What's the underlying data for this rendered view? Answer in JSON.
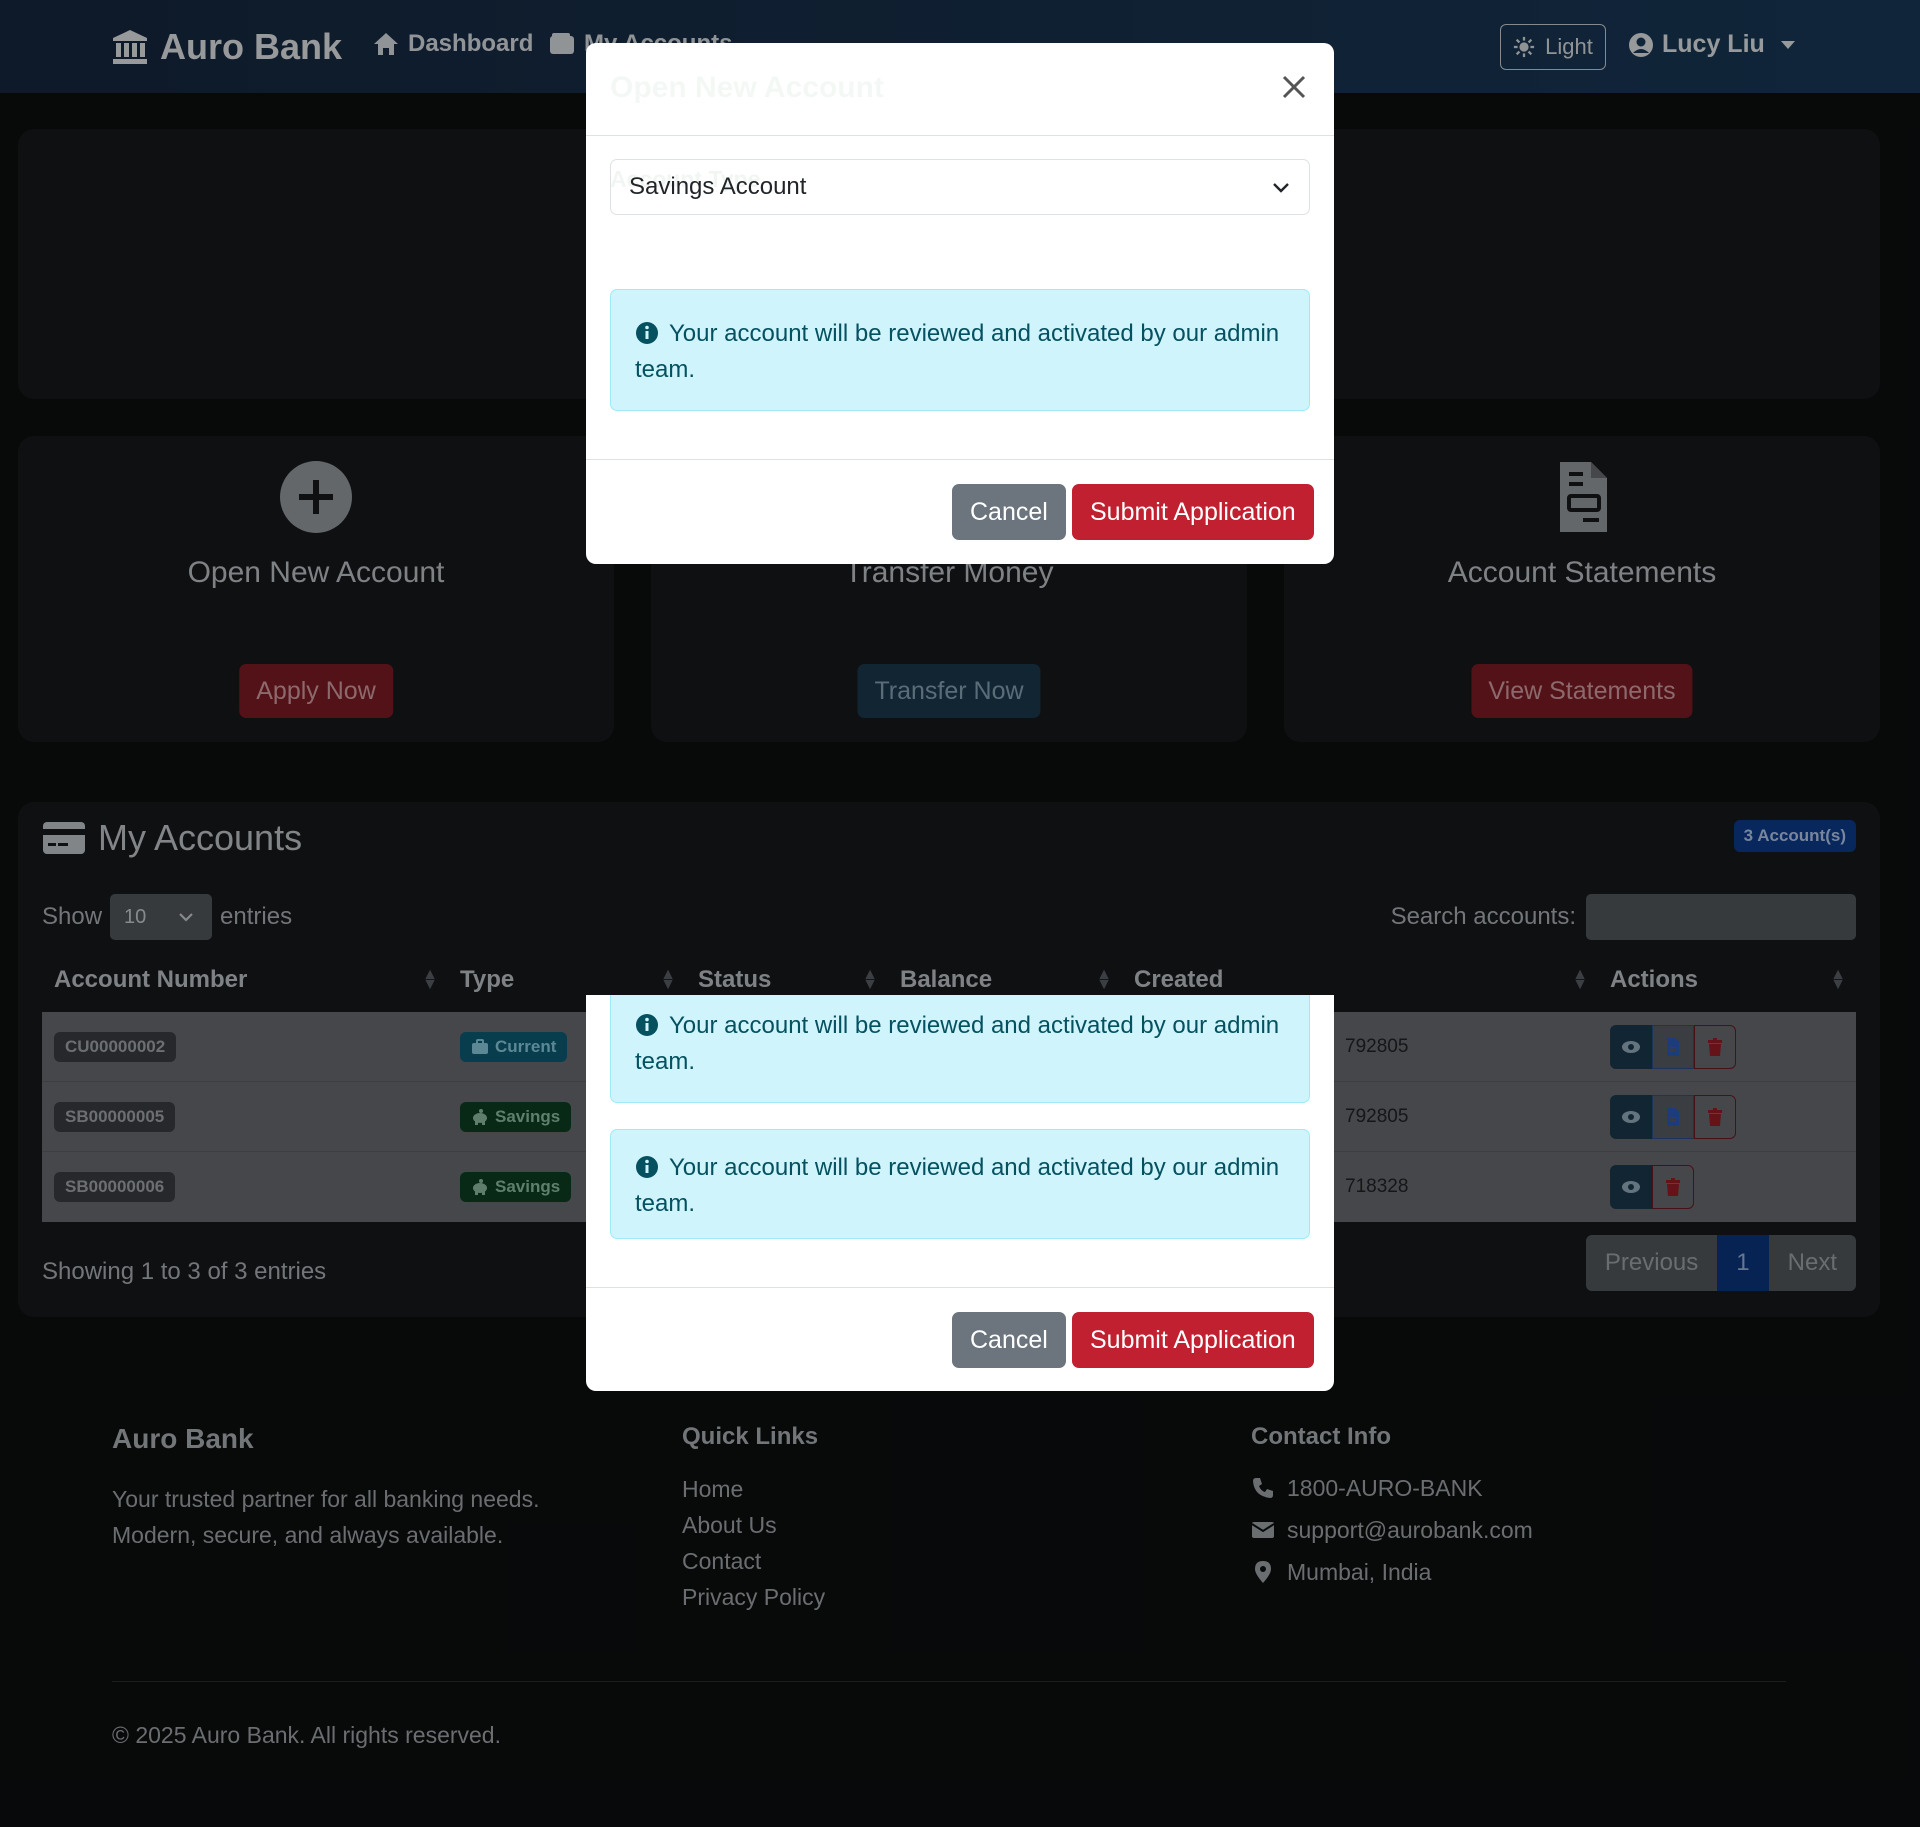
{
  "navbar": {
    "brand": "Auro Bank",
    "links": [
      {
        "label": "Dashboard",
        "icon": "home-icon"
      },
      {
        "label": "My Accounts",
        "icon": "wallet-icon"
      }
    ],
    "theme_toggle": "Light",
    "user_name": "Lucy Liu"
  },
  "quick_actions": [
    {
      "title": "Open New Account",
      "button": "Apply Now",
      "icon": "plus-circle-icon"
    },
    {
      "title": "Transfer Money",
      "button": "Transfer Now",
      "icon": "exchange-icon"
    },
    {
      "title": "Account Statements",
      "button": "View Statements",
      "icon": "file-invoice-icon"
    }
  ],
  "accounts": {
    "title": "My Accounts",
    "badge": "3 Account(s)",
    "show_label": "Show",
    "entries_value": "10",
    "entries_label": "entries",
    "search_label": "Search accounts:",
    "columns": [
      "Account Number",
      "Type",
      "Status",
      "Balance",
      "Created",
      "Actions"
    ],
    "rows": [
      {
        "number": "CU00000002",
        "type": "Current",
        "created": "792805"
      },
      {
        "number": "SB00000005",
        "type": "Savings",
        "created": "792805"
      },
      {
        "number": "SB00000006",
        "type": "Savings",
        "created": "718328"
      }
    ],
    "showing": "Showing 1 to 3 of 3 entries",
    "pager": {
      "prev": "Previous",
      "page": "1",
      "next": "Next"
    }
  },
  "footer": {
    "brand": "Auro Bank",
    "tagline_1": "Your trusted partner for all banking needs.",
    "tagline_2": "Modern, secure, and always available.",
    "quick_links_title": "Quick Links",
    "quick_links": [
      "Home",
      "About Us",
      "Contact",
      "Privacy Policy"
    ],
    "contact_title": "Contact Info",
    "phone": "1800-AURO-BANK",
    "email": "support@aurobank.com",
    "address": "Mumbai, India",
    "copyright": "© 2025 Auro Bank. All rights reserved."
  },
  "modal": {
    "title": "Open New Account",
    "field_label": "Account Type",
    "selected_type": "Savings Account",
    "info_text": "Your account will be reviewed and activated by our admin team.",
    "cancel": "Cancel",
    "submit": "Submit Application"
  },
  "colors": {
    "navbar": "#16283f",
    "primary_red": "#c0202f",
    "info_bg": "#cff4fc",
    "badge_blue": "#0d3c8f"
  }
}
